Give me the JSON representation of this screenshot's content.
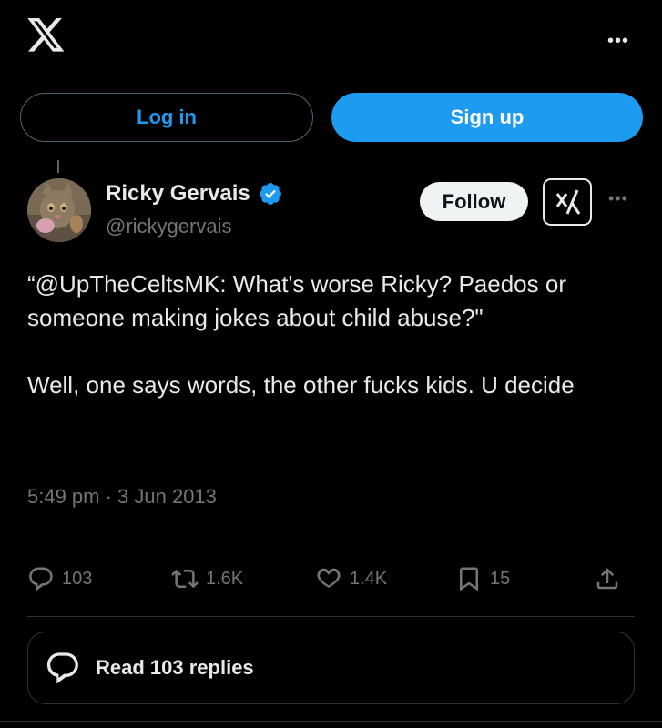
{
  "header": {
    "logo_icon": "x-logo-icon",
    "more_icon": "more-horizontal-icon"
  },
  "auth": {
    "login_label": "Log in",
    "signup_label": "Sign up"
  },
  "tweet": {
    "author_name": "Ricky Gervais",
    "author_handle": "@rickygervais",
    "verified": true,
    "follow_label": "Follow",
    "text": "“@UpTheCeltsMK: What's worse Ricky? Paedos or someone making jokes about child abuse?\"\n\nWell, one says words, the other fucks kids. U decide",
    "timestamp": "5:49 pm · 3 Jun 2013"
  },
  "stats": {
    "replies": "103",
    "retweets": "1.6K",
    "likes": "1.4K",
    "bookmarks": "15"
  },
  "read_replies_label": "Read 103 replies",
  "colors": {
    "accent": "#1d9bf0",
    "background": "#000000",
    "text": "#e7e9ea",
    "muted": "#71767b"
  }
}
